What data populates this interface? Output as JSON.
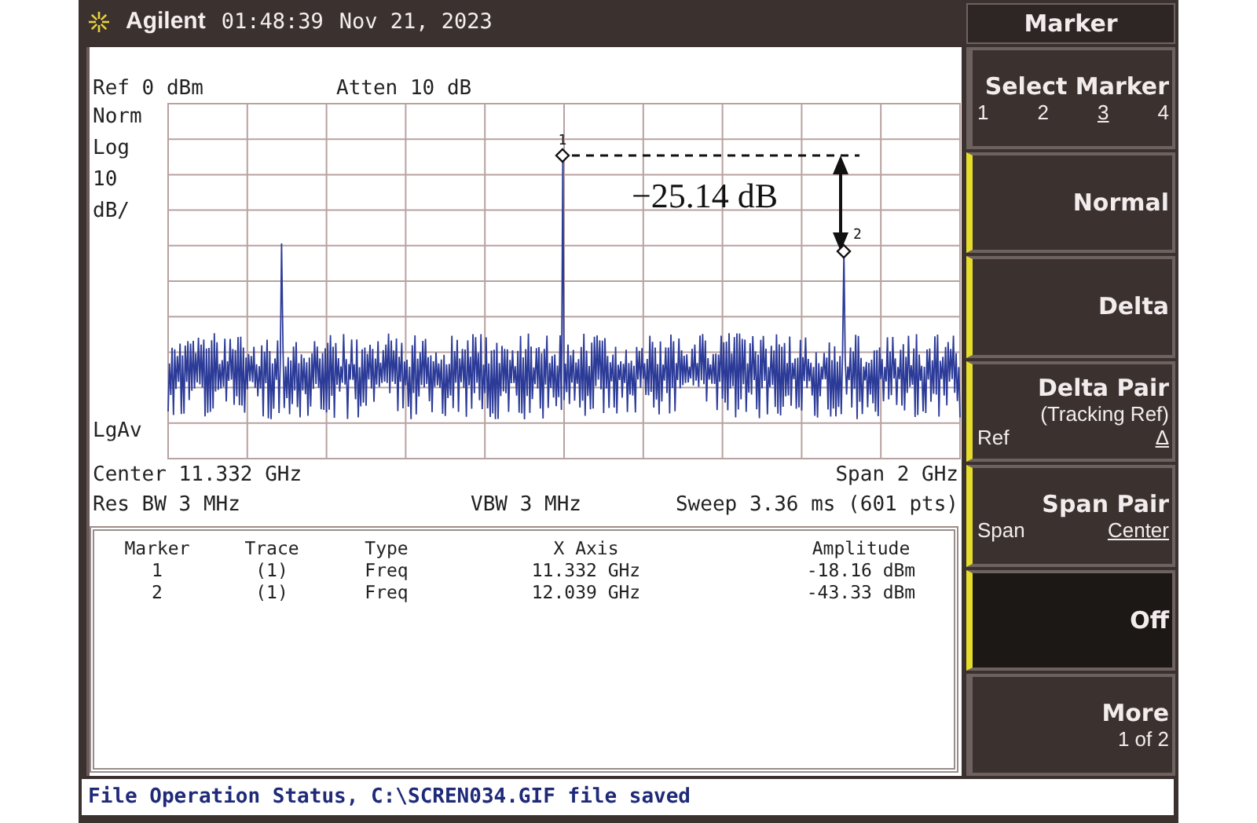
{
  "header": {
    "brand": "Agilent",
    "time": "01:48:39",
    "date": "Nov 21, 2023"
  },
  "display": {
    "ref": "Ref 0 dBm",
    "atten": "Atten 10 dB",
    "scale_labels": [
      "Norm",
      "Log",
      "10",
      "dB/"
    ],
    "detector": "LgAv",
    "markers": [
      {
        "label": "1"
      },
      {
        "label": "2"
      }
    ],
    "delta_annotation": "−25.14 dB",
    "center": "Center 11.332 GHz",
    "span": "Span 2 GHz",
    "res_bw": "Res BW 3 MHz",
    "vbw": "VBW 3 MHz",
    "sweep": "Sweep 3.36 ms (601 pts)"
  },
  "marker_table": {
    "columns": [
      "Marker",
      "Trace",
      "Type",
      "X Axis",
      "Amplitude"
    ],
    "rows": [
      [
        "1",
        "(1)",
        "Freq",
        "11.332 GHz",
        "-18.16 dBm"
      ],
      [
        "2",
        "(1)",
        "Freq",
        "12.039 GHz",
        "-43.33 dBm"
      ]
    ]
  },
  "softkeys": {
    "title": "Marker",
    "keys": [
      {
        "kind": "select",
        "label": "Select Marker",
        "grouped": false,
        "options": [
          {
            "label": "1",
            "selected": false
          },
          {
            "label": "2",
            "selected": false
          },
          {
            "label": "3",
            "selected": true
          },
          {
            "label": "4",
            "selected": false
          }
        ]
      },
      {
        "kind": "plain",
        "label": "Normal",
        "grouped": true,
        "selected": false
      },
      {
        "kind": "plain",
        "label": "Delta",
        "grouped": true,
        "selected": false
      },
      {
        "kind": "toggle",
        "label": "Delta Pair",
        "sublabel": "(Tracking Ref)",
        "grouped": true,
        "selected": false,
        "options": [
          {
            "label": "Ref",
            "selected": false
          },
          {
            "label": "Δ",
            "selected": true
          }
        ]
      },
      {
        "kind": "toggle",
        "label": "Span Pair",
        "grouped": true,
        "selected": false,
        "options": [
          {
            "label": "Span",
            "selected": false
          },
          {
            "label": "Center",
            "selected": true
          }
        ]
      },
      {
        "kind": "plain",
        "label": "Off",
        "grouped": true,
        "selected": true
      },
      {
        "kind": "more",
        "label": "More",
        "sublabel": "1 of 2",
        "grouped": false
      }
    ]
  },
  "status_bar": "File Operation Status, C:\\SCREN034.GIF file saved"
}
